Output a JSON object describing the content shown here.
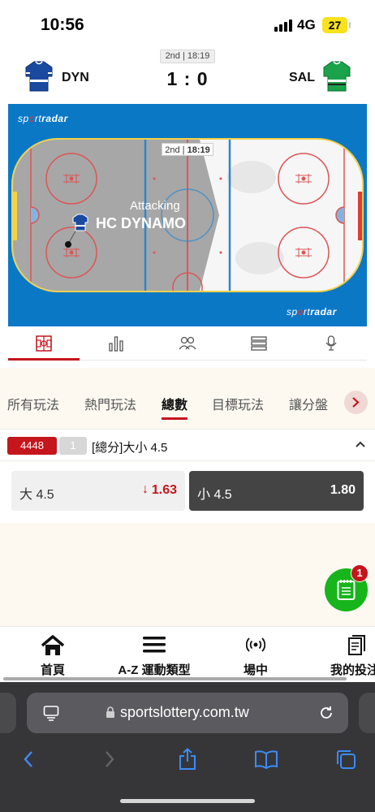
{
  "status": {
    "time": "10:56",
    "network": "4G",
    "battery": "27"
  },
  "match": {
    "period": "2nd | 18:19",
    "home": {
      "abbr": "DYN",
      "color": "#1a4aa0"
    },
    "away": {
      "abbr": "SAL",
      "color": "#1aa34a"
    },
    "score": "1 : 0"
  },
  "tracker": {
    "brand_prefix": "sp",
    "brand_dot": "o",
    "brand_mid": "rt",
    "brand_suffix": "radar",
    "clock_period": "2nd",
    "clock_time": "18:19",
    "state": "Attacking",
    "team": "HC DYNAMO",
    "tabs": [
      "field-icon",
      "stats-icon",
      "lineup-icon",
      "list-icon",
      "commentary-icon"
    ]
  },
  "market": {
    "categories": [
      {
        "label": "所有玩法"
      },
      {
        "label": "熱門玩法"
      },
      {
        "label": "總數"
      },
      {
        "label": "目標玩法"
      },
      {
        "label": "讓分盤"
      }
    ],
    "id": "4448",
    "count": "1",
    "title": "[總分]大小 4.5",
    "over": {
      "label": "大 4.5",
      "odds": "1.63",
      "trend": "↓"
    },
    "under": {
      "label": "小 4.5",
      "odds": "1.80"
    }
  },
  "bet_slip": {
    "count": "1"
  },
  "bottom_nav": [
    {
      "label": "首頁",
      "icon": "home-icon"
    },
    {
      "label": "A-Z 運動類型",
      "icon": "menu-icon"
    },
    {
      "label": "場中",
      "icon": "live-icon"
    },
    {
      "label": "我的投注",
      "icon": "bets-icon"
    }
  ],
  "browser": {
    "url": "sportslottery.com.tw"
  },
  "colors": {
    "accent": "#c4161c",
    "rink_blue": "#0b78c6",
    "slip_green": "#17b51b"
  }
}
